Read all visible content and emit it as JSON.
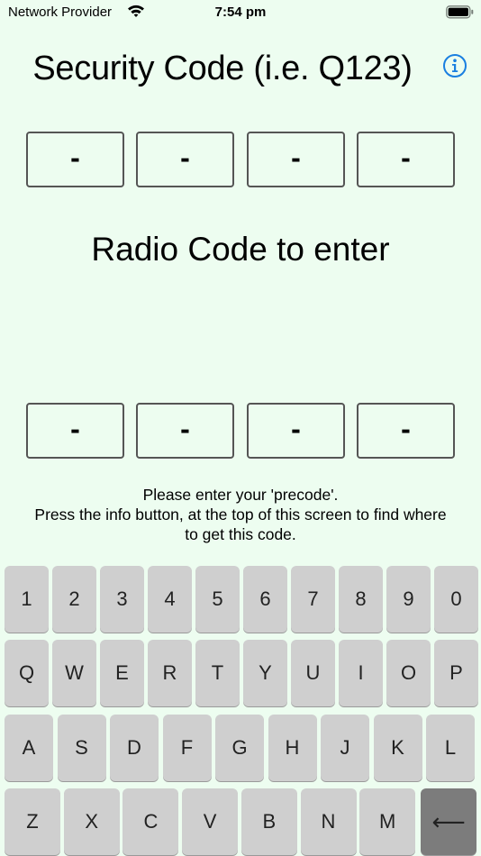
{
  "status_bar": {
    "carrier": "Network Provider",
    "time": "7:54 pm",
    "wifi_icon": "wifi-icon",
    "battery_icon": "battery-icon"
  },
  "header": {
    "title": "Security Code (i.e. Q123)",
    "info_icon": "info-circle-icon"
  },
  "security_code": {
    "digits": [
      "-",
      "-",
      "-",
      "-"
    ]
  },
  "radio_code": {
    "heading": "Radio Code to enter",
    "digits": [
      "-",
      "-",
      "-",
      "-"
    ]
  },
  "instructions": {
    "line1": "Please enter your 'precode'.",
    "line2": "Press the info button, at the top of this screen to find where",
    "line3": "to get this code."
  },
  "keyboard": {
    "row1": [
      "1",
      "2",
      "3",
      "4",
      "5",
      "6",
      "7",
      "8",
      "9",
      "0"
    ],
    "row2": [
      "Q",
      "W",
      "E",
      "R",
      "T",
      "Y",
      "U",
      "I",
      "O",
      "P"
    ],
    "row3": [
      "A",
      "S",
      "D",
      "F",
      "G",
      "H",
      "J",
      "K",
      "L"
    ],
    "row4": [
      "Z",
      "X",
      "C",
      "V",
      "B",
      "N",
      "M"
    ],
    "backspace": "⟵"
  },
  "colors": {
    "background": "#edfdf0",
    "accent": "#1a7fe0",
    "key": "#cfcfcf",
    "backspace_key": "#7c7c7c"
  }
}
